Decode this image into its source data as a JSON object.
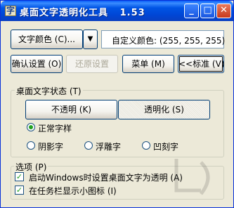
{
  "window": {
    "title": "桌面文字透明化工具",
    "version": "1.53"
  },
  "buttons": {
    "text_color": "文字颜色 (C)...",
    "dropdown_arrow": "▼",
    "confirm": "确认设置 (O)",
    "restore": "还原设置",
    "menu": "菜单 (M)",
    "standard": "<<标准 (V)"
  },
  "custom_color": "自定义颜色: (255, 255, 255)",
  "desktop_text_state": {
    "label": "桌面文字状态 (T)",
    "opaque": "不透明 (K)",
    "transparent": "透明化 (S)",
    "styles": [
      "正常字样",
      "阴影字",
      "浮雕字",
      "凹刻字"
    ],
    "selected_style": "正常字样"
  },
  "options": {
    "label": "选项 (P)",
    "items": [
      {
        "text": "启动Windows时设置桌面文字为透明 (A)",
        "checked": true
      },
      {
        "text": "在任务栏显示小图标 (I)",
        "checked": true
      }
    ]
  },
  "icons": [
    "app-icon",
    "minimize-icon",
    "maximize-icon",
    "close-icon",
    "dropdown-arrow-icon",
    "check-icon"
  ]
}
